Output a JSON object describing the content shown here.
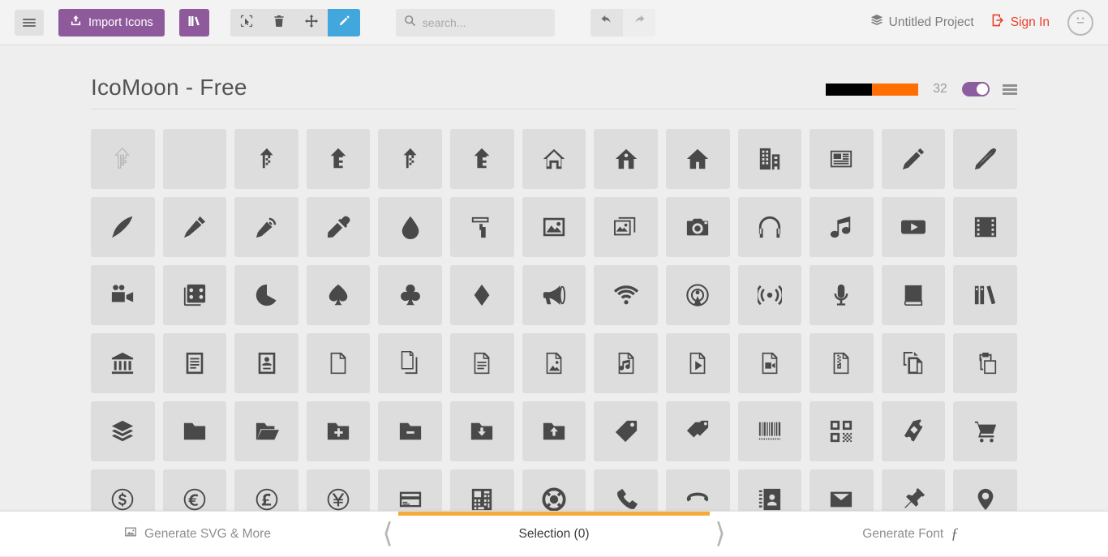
{
  "toolbar": {
    "menu_icon": "hamburger-icon",
    "import_label": "Import Icons",
    "import_icon": "upload-icon",
    "library_icon": "books-icon",
    "tools": [
      {
        "name": "select",
        "icon": "cursor-select-icon",
        "active": false
      },
      {
        "name": "delete",
        "icon": "trash-icon",
        "active": false
      },
      {
        "name": "move",
        "icon": "move-arrows-icon",
        "active": false
      },
      {
        "name": "edit",
        "icon": "pencil-icon",
        "active": true
      }
    ],
    "search_placeholder": "search...",
    "search_value": "",
    "search_icon": "search-icon",
    "undo_icon": "undo-arrow-icon",
    "redo_icon": "redo-arrow-icon",
    "project_label": "Untitled Project",
    "project_icon": "stack-icon",
    "signin_label": "Sign In",
    "signin_icon": "login-icon",
    "avatar_icon": "neutral-face-icon",
    "accent_purple": "#8e5a9c",
    "accent_blue": "#41a7dd",
    "accent_red": "#e8402a"
  },
  "set": {
    "title": "IcoMoon - Free",
    "swatches": [
      "#000000",
      "#ff6e00"
    ],
    "size": "32",
    "toggle_on": true,
    "menu_icon": "set-menu-icon"
  },
  "icons": [
    {
      "name": "icomoon-outline",
      "style": "outline"
    },
    {
      "name": "blank",
      "style": "blank"
    },
    {
      "name": "icomoon-1",
      "style": "solid"
    },
    {
      "name": "icomoon-2",
      "style": "solid"
    },
    {
      "name": "icomoon-3",
      "style": "solid"
    },
    {
      "name": "icomoon-4",
      "style": "solid"
    },
    {
      "name": "home",
      "style": "solid"
    },
    {
      "name": "home2",
      "style": "solid"
    },
    {
      "name": "home3",
      "style": "solid"
    },
    {
      "name": "office",
      "style": "solid"
    },
    {
      "name": "newspaper",
      "style": "solid"
    },
    {
      "name": "pencil",
      "style": "solid"
    },
    {
      "name": "pencil2",
      "style": "solid"
    },
    {
      "name": "quill",
      "style": "solid"
    },
    {
      "name": "pen",
      "style": "solid"
    },
    {
      "name": "blog",
      "style": "solid"
    },
    {
      "name": "eyedropper",
      "style": "solid"
    },
    {
      "name": "droplet",
      "style": "solid"
    },
    {
      "name": "paint-format",
      "style": "solid"
    },
    {
      "name": "image",
      "style": "solid"
    },
    {
      "name": "images",
      "style": "solid"
    },
    {
      "name": "camera",
      "style": "solid"
    },
    {
      "name": "headphones",
      "style": "solid"
    },
    {
      "name": "music",
      "style": "solid"
    },
    {
      "name": "play",
      "style": "solid"
    },
    {
      "name": "film",
      "style": "solid"
    },
    {
      "name": "video-camera",
      "style": "solid"
    },
    {
      "name": "dice",
      "style": "solid"
    },
    {
      "name": "pacman",
      "style": "solid"
    },
    {
      "name": "spades",
      "style": "solid"
    },
    {
      "name": "clubs",
      "style": "solid"
    },
    {
      "name": "diamonds",
      "style": "solid"
    },
    {
      "name": "bullhorn",
      "style": "solid"
    },
    {
      "name": "connection",
      "style": "solid"
    },
    {
      "name": "podcast",
      "style": "solid"
    },
    {
      "name": "feed",
      "style": "solid"
    },
    {
      "name": "mic",
      "style": "solid"
    },
    {
      "name": "book",
      "style": "solid"
    },
    {
      "name": "books",
      "style": "solid"
    },
    {
      "name": "library",
      "style": "solid"
    },
    {
      "name": "file-text",
      "style": "solid"
    },
    {
      "name": "profile",
      "style": "solid"
    },
    {
      "name": "file-empty",
      "style": "solid"
    },
    {
      "name": "files-empty",
      "style": "solid"
    },
    {
      "name": "file-text2",
      "style": "solid"
    },
    {
      "name": "file-picture",
      "style": "solid"
    },
    {
      "name": "file-music",
      "style": "solid"
    },
    {
      "name": "file-play",
      "style": "solid"
    },
    {
      "name": "file-video",
      "style": "solid"
    },
    {
      "name": "file-zip",
      "style": "solid"
    },
    {
      "name": "copy",
      "style": "solid"
    },
    {
      "name": "paste",
      "style": "solid"
    },
    {
      "name": "stack",
      "style": "solid"
    },
    {
      "name": "folder",
      "style": "solid"
    },
    {
      "name": "folder-open",
      "style": "solid"
    },
    {
      "name": "folder-plus",
      "style": "solid"
    },
    {
      "name": "folder-minus",
      "style": "solid"
    },
    {
      "name": "folder-download",
      "style": "solid"
    },
    {
      "name": "folder-upload",
      "style": "solid"
    },
    {
      "name": "price-tag",
      "style": "solid"
    },
    {
      "name": "price-tags",
      "style": "solid"
    },
    {
      "name": "barcode",
      "style": "solid"
    },
    {
      "name": "qrcode",
      "style": "solid"
    },
    {
      "name": "ticket",
      "style": "solid"
    },
    {
      "name": "cart",
      "style": "solid"
    },
    {
      "name": "coin-dollar",
      "style": "solid"
    },
    {
      "name": "coin-euro",
      "style": "solid"
    },
    {
      "name": "coin-pound",
      "style": "solid"
    },
    {
      "name": "coin-yen",
      "style": "solid"
    },
    {
      "name": "credit-card",
      "style": "solid"
    },
    {
      "name": "calculator",
      "style": "solid"
    },
    {
      "name": "lifebuoy",
      "style": "solid"
    },
    {
      "name": "phone",
      "style": "solid"
    },
    {
      "name": "phone-hang-up",
      "style": "solid"
    },
    {
      "name": "address-book",
      "style": "solid"
    },
    {
      "name": "envelop",
      "style": "solid"
    },
    {
      "name": "pushpin",
      "style": "solid"
    },
    {
      "name": "location",
      "style": "solid"
    }
  ],
  "bottom": {
    "generate_svg_label": "Generate SVG & More",
    "generate_svg_icon": "image-icon",
    "selection_label": "Selection (0)",
    "generate_font_label": "Generate Font",
    "generate_font_icon": "f-glyph-icon",
    "accent": "#f5ab3b"
  }
}
